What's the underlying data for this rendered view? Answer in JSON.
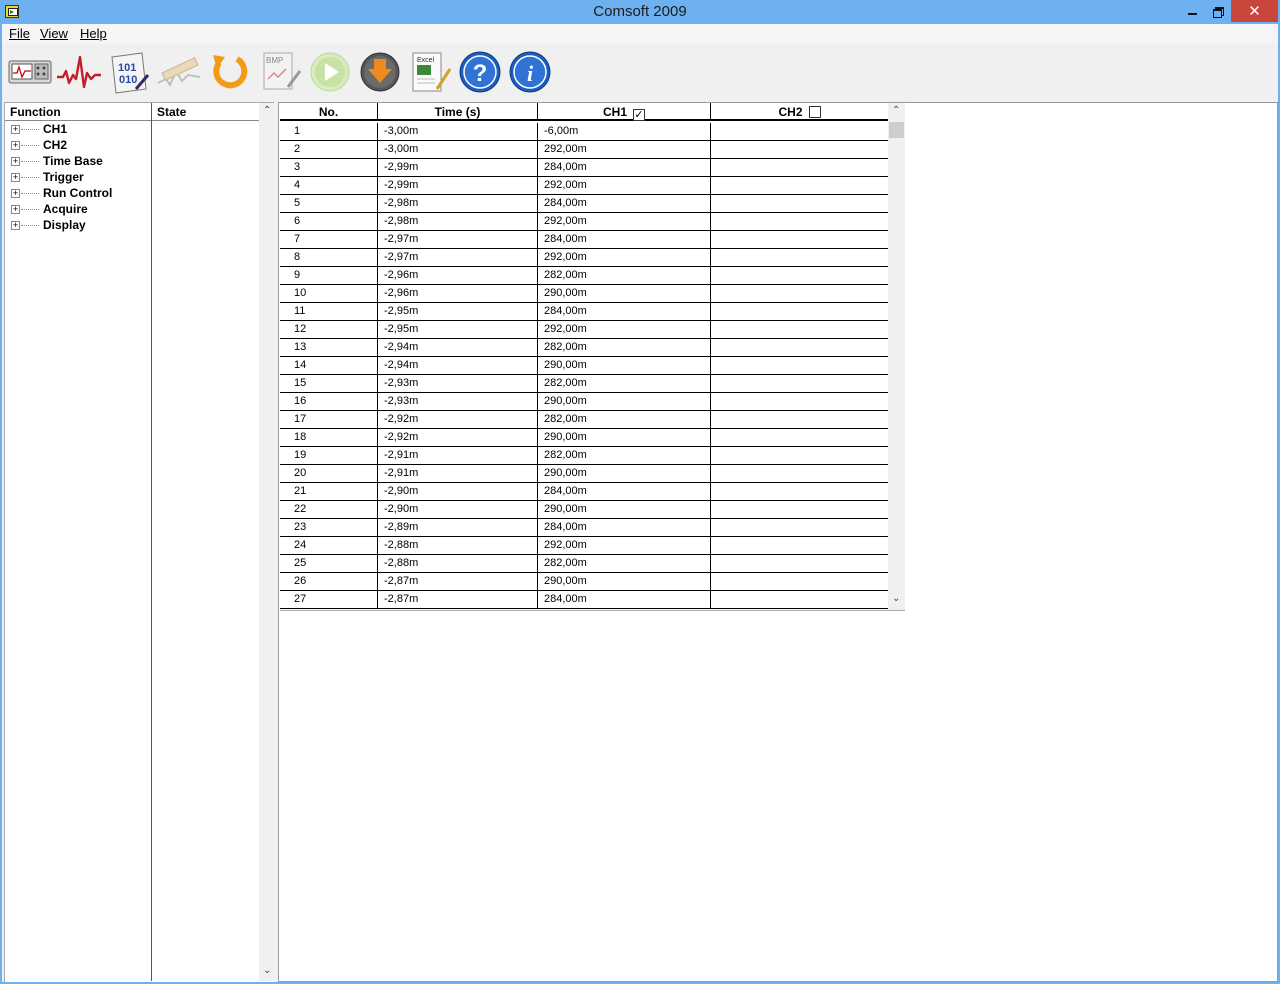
{
  "window": {
    "title": "Comsoft 2009",
    "close_glyph": "✕"
  },
  "menu": [
    {
      "label": "File"
    },
    {
      "label": "View"
    },
    {
      "label": "Help"
    }
  ],
  "toolbar": {
    "icons": [
      "oscilloscope-icon",
      "waveform-icon",
      "binary-data-icon",
      "measure-icon",
      "refresh-icon",
      "bmp-export-icon",
      "run-icon",
      "download-icon",
      "excel-export-icon",
      "help-icon",
      "info-icon"
    ]
  },
  "tree": {
    "headers": {
      "function": "Function",
      "state": "State"
    },
    "items": [
      {
        "label": "CH1"
      },
      {
        "label": "CH2"
      },
      {
        "label": "Time Base"
      },
      {
        "label": "Trigger"
      },
      {
        "label": "Run Control"
      },
      {
        "label": "Acquire"
      },
      {
        "label": "Display"
      }
    ]
  },
  "table": {
    "headers": {
      "no": "No.",
      "time": "Time (s)",
      "ch1": "CH1",
      "ch2": "CH2"
    },
    "ch1_checked": true,
    "ch2_checked": false,
    "rows": [
      {
        "no": "1",
        "time": "-3,00m",
        "ch1": "-6,00m",
        "ch2": ""
      },
      {
        "no": "2",
        "time": "-3,00m",
        "ch1": "292,00m",
        "ch2": ""
      },
      {
        "no": "3",
        "time": "-2,99m",
        "ch1": "284,00m",
        "ch2": ""
      },
      {
        "no": "4",
        "time": "-2,99m",
        "ch1": "292,00m",
        "ch2": ""
      },
      {
        "no": "5",
        "time": "-2,98m",
        "ch1": "284,00m",
        "ch2": ""
      },
      {
        "no": "6",
        "time": "-2,98m",
        "ch1": "292,00m",
        "ch2": ""
      },
      {
        "no": "7",
        "time": "-2,97m",
        "ch1": "284,00m",
        "ch2": ""
      },
      {
        "no": "8",
        "time": "-2,97m",
        "ch1": "292,00m",
        "ch2": ""
      },
      {
        "no": "9",
        "time": "-2,96m",
        "ch1": "282,00m",
        "ch2": ""
      },
      {
        "no": "10",
        "time": "-2,96m",
        "ch1": "290,00m",
        "ch2": ""
      },
      {
        "no": "11",
        "time": "-2,95m",
        "ch1": "284,00m",
        "ch2": ""
      },
      {
        "no": "12",
        "time": "-2,95m",
        "ch1": "292,00m",
        "ch2": ""
      },
      {
        "no": "13",
        "time": "-2,94m",
        "ch1": "282,00m",
        "ch2": ""
      },
      {
        "no": "14",
        "time": "-2,94m",
        "ch1": "290,00m",
        "ch2": ""
      },
      {
        "no": "15",
        "time": "-2,93m",
        "ch1": "282,00m",
        "ch2": ""
      },
      {
        "no": "16",
        "time": "-2,93m",
        "ch1": "290,00m",
        "ch2": ""
      },
      {
        "no": "17",
        "time": "-2,92m",
        "ch1": "282,00m",
        "ch2": ""
      },
      {
        "no": "18",
        "time": "-2,92m",
        "ch1": "290,00m",
        "ch2": ""
      },
      {
        "no": "19",
        "time": "-2,91m",
        "ch1": "282,00m",
        "ch2": ""
      },
      {
        "no": "20",
        "time": "-2,91m",
        "ch1": "290,00m",
        "ch2": ""
      },
      {
        "no": "21",
        "time": "-2,90m",
        "ch1": "284,00m",
        "ch2": ""
      },
      {
        "no": "22",
        "time": "-2,90m",
        "ch1": "290,00m",
        "ch2": ""
      },
      {
        "no": "23",
        "time": "-2,89m",
        "ch1": "284,00m",
        "ch2": ""
      },
      {
        "no": "24",
        "time": "-2,88m",
        "ch1": "292,00m",
        "ch2": ""
      },
      {
        "no": "25",
        "time": "-2,88m",
        "ch1": "282,00m",
        "ch2": ""
      },
      {
        "no": "26",
        "time": "-2,87m",
        "ch1": "290,00m",
        "ch2": ""
      },
      {
        "no": "27",
        "time": "-2,87m",
        "ch1": "284,00m",
        "ch2": ""
      }
    ]
  }
}
